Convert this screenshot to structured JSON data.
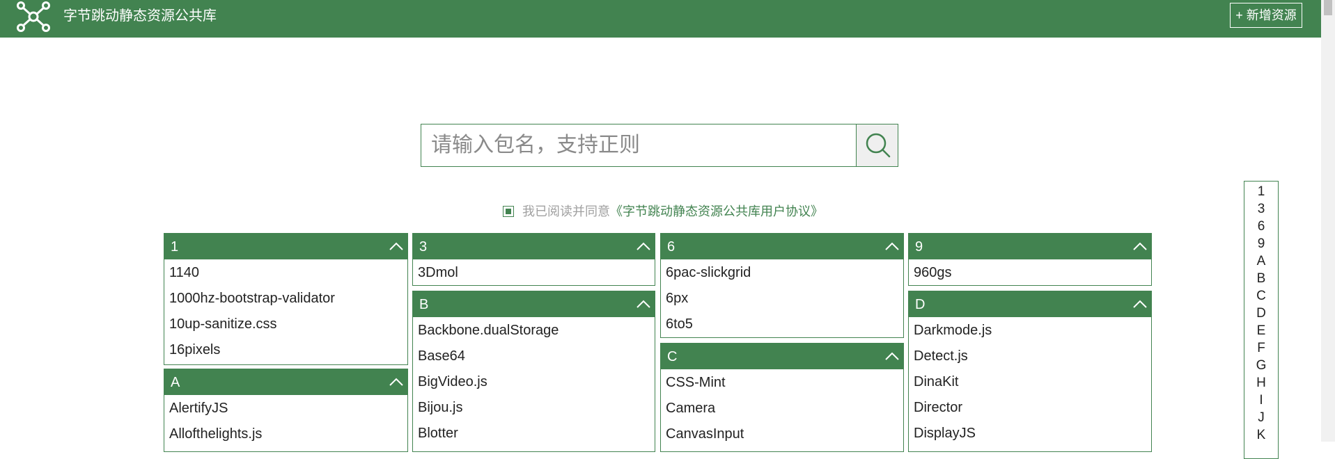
{
  "header": {
    "title": "字节跳动静态资源公共库",
    "add_button": "+ 新增资源",
    "logo_icon": "network-nodes-icon"
  },
  "search": {
    "placeholder": "请输入包名，支持正则",
    "value": "",
    "button_icon": "search-icon"
  },
  "agreement": {
    "checked": true,
    "text": "我已阅读并同意",
    "link": "《字节跳动静态资源公共库用户协议》"
  },
  "colors": {
    "brand": "#428350",
    "text": "#222222",
    "muted": "#a0a0a0"
  },
  "groups": [
    {
      "letter": "1",
      "items": [
        "1140",
        "1000hz-bootstrap-validator",
        "10up-sanitize.css",
        "16pixels"
      ]
    },
    {
      "letter": "A",
      "items": [
        "AlertifyJS",
        "Allofthelights.js"
      ]
    },
    {
      "letter": "3",
      "items": [
        "3Dmol"
      ]
    },
    {
      "letter": "B",
      "items": [
        "Backbone.dualStorage",
        "Base64",
        "BigVideo.js",
        "Bijou.js",
        "Blotter"
      ]
    },
    {
      "letter": "6",
      "items": [
        "6pac-slickgrid",
        "6px",
        "6to5"
      ]
    },
    {
      "letter": "C",
      "items": [
        "CSS-Mint",
        "Camera",
        "CanvasInput"
      ]
    },
    {
      "letter": "9",
      "items": [
        "960gs"
      ]
    },
    {
      "letter": "D",
      "items": [
        "Darkmode.js",
        "Detect.js",
        "DinaKit",
        "Director",
        "DisplayJS"
      ]
    }
  ],
  "index": [
    "1",
    "3",
    "6",
    "9",
    "A",
    "B",
    "C",
    "D",
    "E",
    "F",
    "G",
    "H",
    "I",
    "J",
    "K"
  ]
}
